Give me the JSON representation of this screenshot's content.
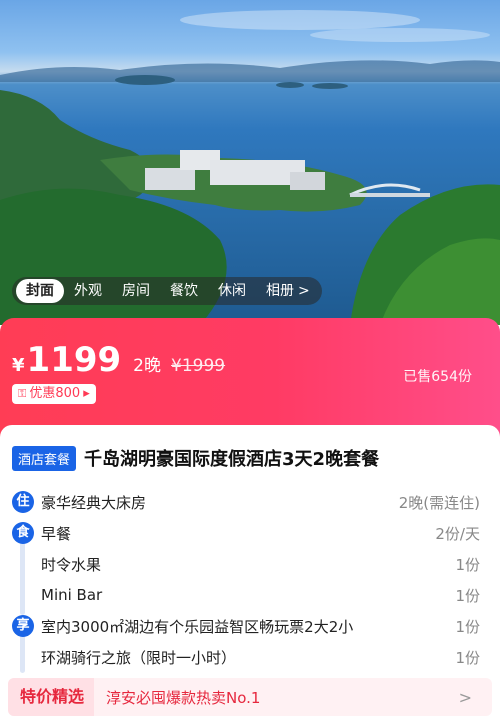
{
  "gallery": {
    "tabs": [
      "封面",
      "外观",
      "房间",
      "餐饮",
      "休闲",
      "相册"
    ],
    "active_tab": "封面",
    "more_arrow": ">"
  },
  "price": {
    "currency": "¥",
    "amount": "1199",
    "nights": "2晚",
    "original": "¥1999",
    "coupon": "优惠800",
    "coupon_arrow": "▸",
    "sold": "已售654份"
  },
  "package": {
    "tag": "酒店套餐",
    "title": "千岛湖明豪国际度假酒店3天2晚套餐",
    "categories": [
      {
        "badge": "住"
      },
      {
        "badge": "食"
      },
      {
        "badge": "享"
      }
    ],
    "items": [
      {
        "name": "豪华经典大床房",
        "qty": "2晚(需连住)"
      },
      {
        "name": "早餐",
        "qty": "2份/天"
      },
      {
        "name": "时令水果",
        "qty": "1份"
      },
      {
        "name": "Mini Bar",
        "qty": "1份"
      },
      {
        "name": "室内3000㎡湖边有个乐园益智区畅玩票2大2小",
        "qty": "1份"
      },
      {
        "name": "环湖骑行之旅（限时一小时）",
        "qty": "1份"
      }
    ]
  },
  "promo": {
    "label": "特价精选",
    "text": "淳安必囤爆款热卖No.1",
    "arrow": ">"
  },
  "colors": {
    "brand_blue": "#1a64e6",
    "banner_red": "#ff3d55",
    "promo_red": "#e6283e"
  }
}
